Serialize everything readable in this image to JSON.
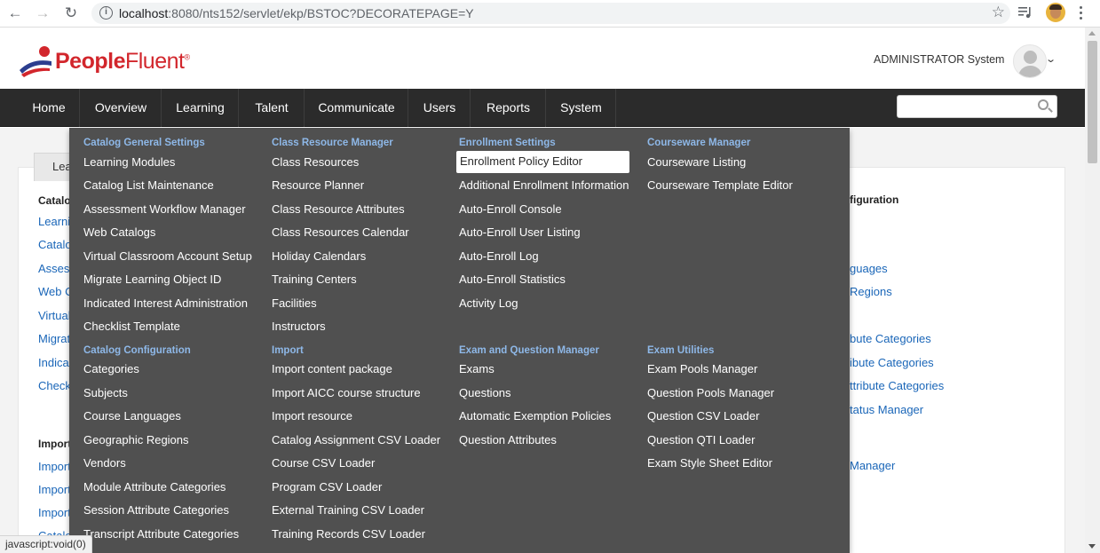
{
  "browser": {
    "url_host": "localhost",
    "url_path": ":8080/nts152/servlet/ekp/BSTOC?DECORATEPAGE=Y",
    "back_icon": "arrow-left-icon",
    "forward_icon": "arrow-right-icon",
    "reload_icon": "reload-icon",
    "status_text": "javascript:void(0)"
  },
  "header": {
    "logo_text_1": "People",
    "logo_text_2": "Fluent",
    "logo_mark": "®",
    "user_name": "ADMINISTRATOR System"
  },
  "nav": {
    "items": [
      "Home",
      "Overview",
      "Learning",
      "Talent",
      "Communicate",
      "Users",
      "Reports",
      "System"
    ],
    "search_placeholder": ""
  },
  "background": {
    "tab_label": "Lea",
    "left_texts": [
      "Catalo",
      "Learni",
      "Catalo",
      "Asses",
      "Web C",
      "Virtual",
      "Migrat",
      "Indica",
      "Check",
      "Import",
      "Import",
      "Import",
      "Import",
      "Catalo"
    ],
    "right_texts": [
      "figuration",
      "guages",
      "Regions",
      "bute Categories",
      "ibute Categories",
      "ttribute Categories",
      "tatus Manager",
      "Manager"
    ]
  },
  "menu": {
    "col1": {
      "group1_title": "Catalog General Settings",
      "group1_items": [
        "Learning Modules",
        "Catalog List Maintenance",
        "Assessment Workflow Manager",
        "Web Catalogs",
        "Virtual Classroom Account Setup",
        "Migrate Learning Object ID",
        "Indicated Interest Administration",
        "Checklist Template"
      ],
      "group2_title": "Catalog Configuration",
      "group2_items": [
        "Categories",
        "Subjects",
        "Course Languages",
        "Geographic Regions",
        "Vendors",
        "Module Attribute Categories",
        "Session Attribute Categories",
        "Transcript Attribute Categories"
      ]
    },
    "col2": {
      "group1_title": "Class Resource Manager",
      "group1_items": [
        "Class Resources",
        "Resource Planner",
        "Class Resource Attributes",
        "Class Resources Calendar",
        "Holiday Calendars",
        "Training Centers",
        "Facilities",
        "Instructors"
      ],
      "group2_title": "Import",
      "group2_items": [
        "Import content package",
        "Import AICC course structure",
        "Import resource",
        "Catalog Assignment CSV Loader",
        "Course CSV Loader",
        "Program CSV Loader",
        "External Training CSV Loader",
        "Training Records CSV Loader"
      ]
    },
    "col3": {
      "group1_title": "Enrollment Settings",
      "group1_items": [
        "Enrollment Policy Editor",
        "Additional Enrollment Information",
        "Auto-Enroll Console",
        "Auto-Enroll User Listing",
        "Auto-Enroll Log",
        "Auto-Enroll Statistics",
        "Activity Log"
      ],
      "group2_title": "Exam and Question Manager",
      "group2_items": [
        "Exams",
        "Questions",
        "Automatic Exemption Policies",
        "Question Attributes"
      ]
    },
    "col4": {
      "group1_title": "Courseware Manager",
      "group1_items": [
        "Courseware Listing",
        "Courseware Template Editor"
      ],
      "group2_title": "Exam Utilities",
      "group2_items": [
        "Exam Pools Manager",
        "Question Pools Manager",
        "Question CSV Loader",
        "Question QTI Loader",
        "Exam Style Sheet Editor"
      ]
    }
  }
}
